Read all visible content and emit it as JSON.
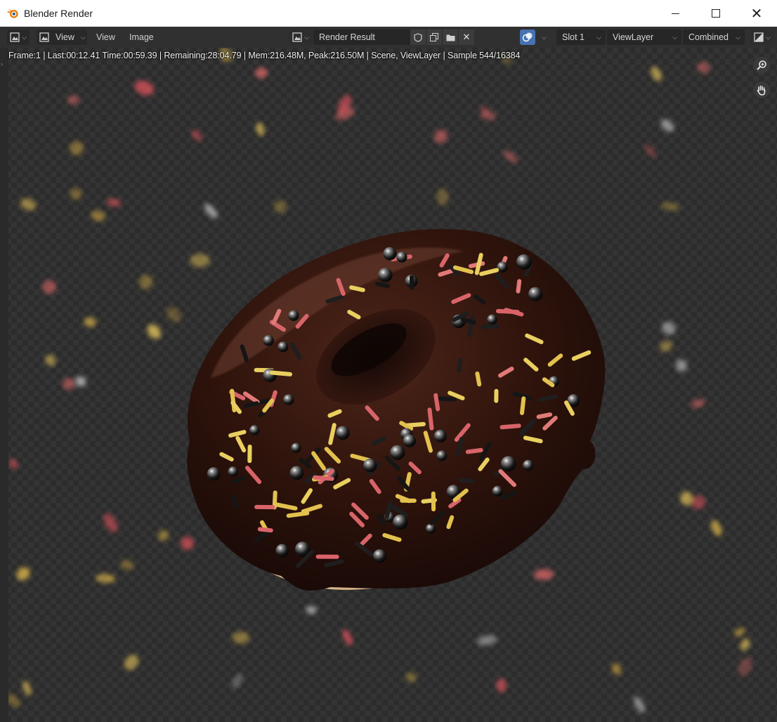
{
  "window": {
    "title": "Blender Render",
    "controls": {
      "minimize": "minimize",
      "maximize": "maximize",
      "close": "✕"
    }
  },
  "header": {
    "editor_type_icon": "image-editor-icon",
    "view_mode_label": "View",
    "menus": [
      "View",
      "Image"
    ],
    "image_name": "Render Result",
    "slot_label": "Slot 1",
    "view_layer_label": "ViewLayer",
    "pass_label": "Combined"
  },
  "viewport": {
    "status_text": "Frame:1 | Last:00:12.41 Time:00:59.39 | Remaining:28:04.79 | Mem:216.48M, Peak:216.50M | Scene, ViewLayer | Sample 544/16384",
    "tools": [
      "zoom-icon",
      "hand-pan-icon"
    ]
  },
  "colors": {
    "titlebar_bg": "#ffffff",
    "header_bg": "#303030",
    "accent_blue": "#4772b3",
    "chocolate_icing": "#2a120c",
    "dough": "#d8b98a"
  }
}
